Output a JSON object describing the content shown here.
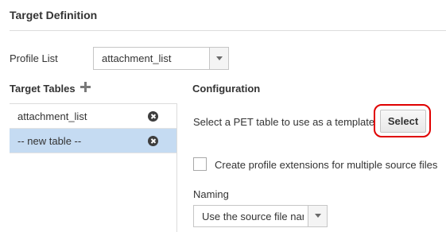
{
  "header": {
    "title": "Target Definition"
  },
  "profile": {
    "label": "Profile List",
    "selected": "attachment_list"
  },
  "target_tables": {
    "title": "Target Tables",
    "items": [
      {
        "label": "attachment_list",
        "selected": false
      },
      {
        "label": "-- new table --",
        "selected": true
      }
    ]
  },
  "configuration": {
    "title": "Configuration",
    "pet_prompt": "Select a PET table to use as a template",
    "select_button": "Select",
    "checkbox_label": "Create profile extensions for multiple source files",
    "checkbox_checked": false,
    "naming_label": "Naming",
    "naming_value": "Use the source file nam"
  },
  "colors": {
    "selected_row": "#c5dbf2",
    "highlight": "#e00000"
  }
}
